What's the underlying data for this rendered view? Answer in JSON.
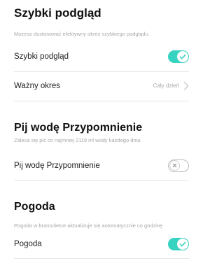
{
  "colors": {
    "accent": "#35d3c0",
    "toggle_off_border": "#bdbdbd",
    "description": "#a8a8a8",
    "divider": "#e6e6e6"
  },
  "quick_view": {
    "title": "Szybki podgląd",
    "description": "Możesz dostosować efektywny okres szybkiego podglądu",
    "toggle_label": "Szybki podgląd",
    "toggle_state": "on",
    "period_label": "Ważny okres",
    "period_value": "Cały dzień"
  },
  "water": {
    "title": "Pij wodę Przypomnienie",
    "description": "Zaleca się pić co najmniej 2119 ml wody każdego dnia",
    "toggle_label": "Pij wodę Przypomnienie",
    "toggle_state": "off"
  },
  "weather": {
    "title": "Pogoda",
    "description": "Pogoda w bransoletce aktualizuje się automatycznie co godzinę",
    "toggle_label": "Pogoda",
    "toggle_state": "on"
  },
  "icons": [
    "check-icon",
    "close-icon",
    "chevron-right-icon"
  ]
}
